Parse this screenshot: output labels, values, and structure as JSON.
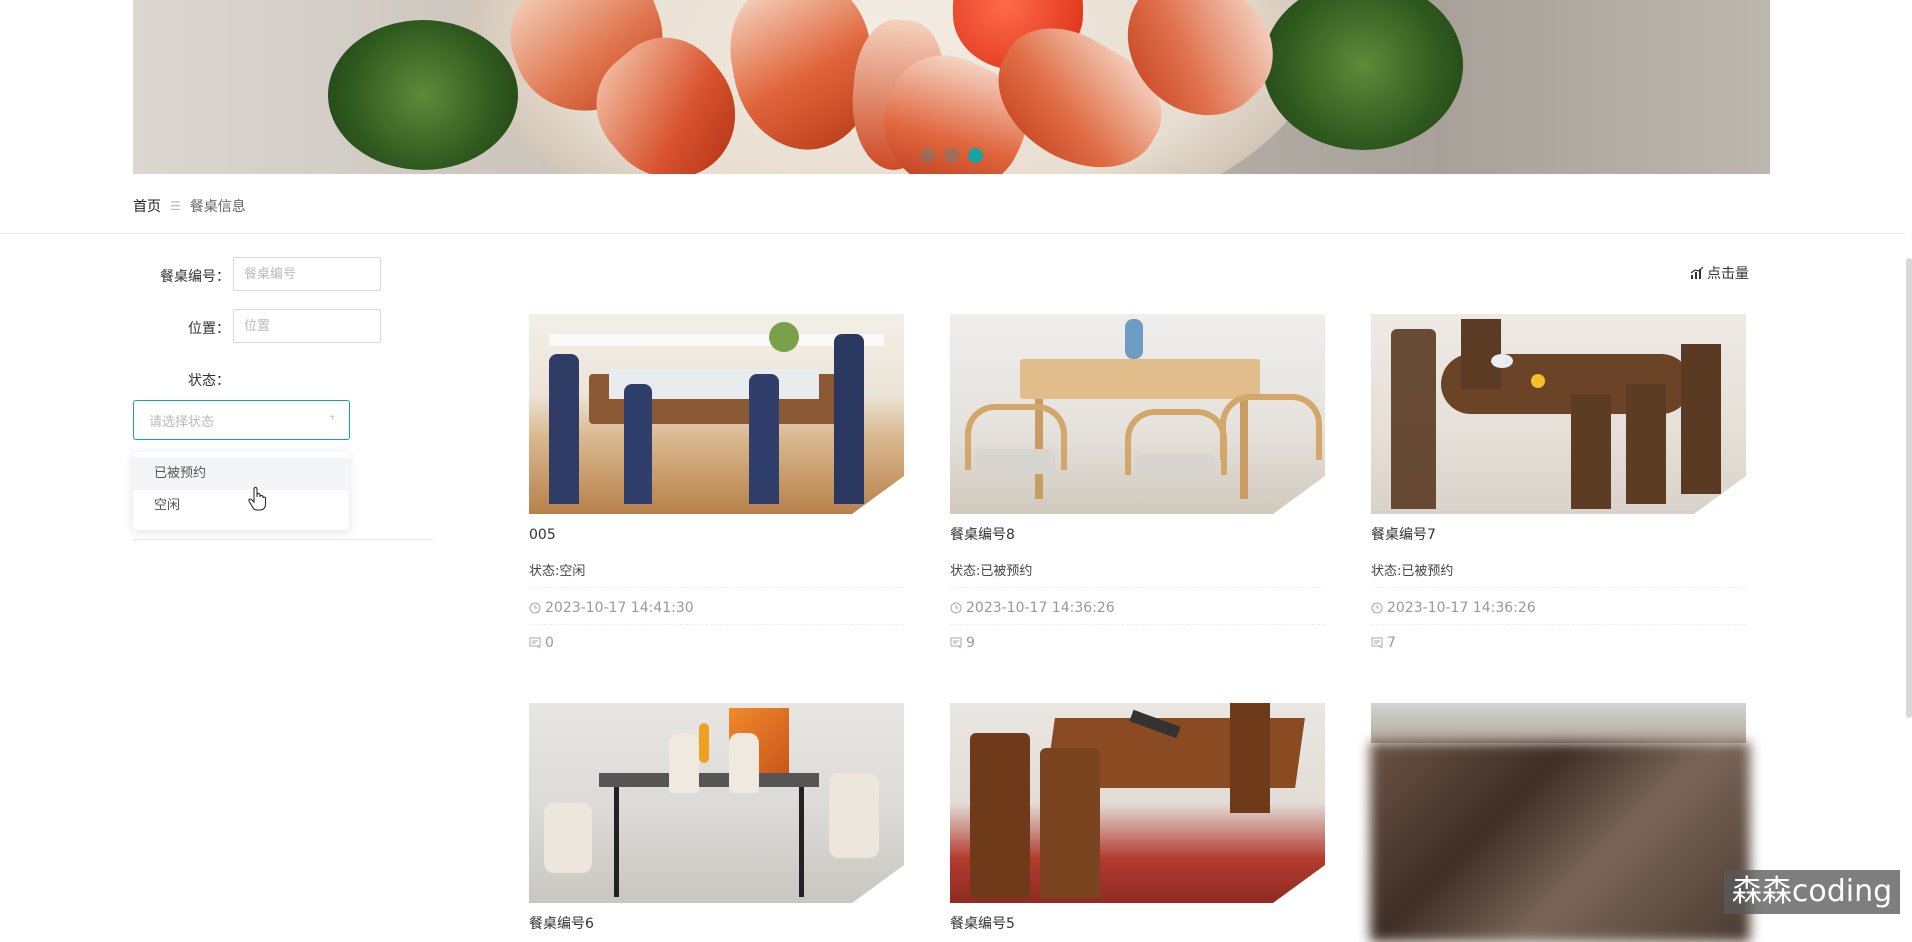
{
  "breadcrumb": {
    "home": "首页",
    "separator": "☰",
    "current": "餐桌信息"
  },
  "banner": {
    "slide_count": 3,
    "active_slide": 3
  },
  "filter": {
    "table_no_label": "餐桌编号：",
    "table_no_placeholder": "餐桌编号",
    "location_label": "位置：",
    "location_placeholder": "位置",
    "status_label": "状态：",
    "status_placeholder": "请选择状态",
    "status_options": [
      "已被预约",
      "空闲"
    ]
  },
  "sort": {
    "label": "点击量",
    "icon": "bar-chart-icon"
  },
  "cards": [
    {
      "title": "005",
      "status": "状态:空闲",
      "date": "2023-10-17 14:41:30",
      "clicks": "0"
    },
    {
      "title": "餐桌编号8",
      "status": "状态:已被预约",
      "date": "2023-10-17 14:36:26",
      "clicks": "9"
    },
    {
      "title": "餐桌编号7",
      "status": "状态:已被预约",
      "date": "2023-10-17 14:36:26",
      "clicks": "7"
    },
    {
      "title": "餐桌编号6"
    },
    {
      "title": "餐桌编号5"
    }
  ],
  "watermark": "森森coding",
  "colors": {
    "accent": "#17a2a5",
    "border": "#d9d9d9"
  }
}
